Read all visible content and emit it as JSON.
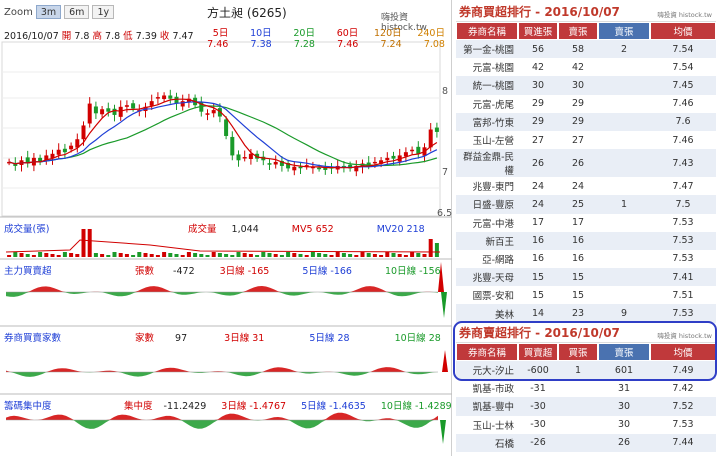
{
  "toolbar": {
    "zoom_label": "Zoom",
    "zoom_options": [
      "3m",
      "6m",
      "1y"
    ],
    "zoom_active": "3m"
  },
  "stock": {
    "title": "方土昶 (6265)",
    "source": "嗨投資 histock.tw",
    "date": "2016/10/07",
    "open_label": "開",
    "open": "7.8",
    "high_label": "高",
    "high": "7.8",
    "low_label": "低",
    "low": "7.39",
    "close_label": "收",
    "close": "7.47"
  },
  "ma": {
    "headers": [
      "5日",
      "10日",
      "20日",
      "60日",
      "120日",
      "240日"
    ],
    "values": [
      "7.46",
      "7.38",
      "7.28",
      "7.46",
      "7.24",
      "7.08"
    ],
    "colors": [
      "#d10000",
      "#1f3fd6",
      "#1a9a2a",
      "#d10000",
      "#c07000",
      "#d08000"
    ]
  },
  "price_axis": [
    "8",
    "7",
    "6.5"
  ],
  "volume": {
    "panel_label": "成交量(張)",
    "vol_label": "成交量",
    "vol_value": "1,044",
    "mv5_label": "MV5",
    "mv5_value": "652",
    "mv20_label": "MV20",
    "mv20_value": "218"
  },
  "main_force": {
    "panel_label": "主力買賣超",
    "value_label": "張數",
    "value": "-472",
    "l3_label": "3日線",
    "l3_value": "-165",
    "l5_label": "5日線",
    "l5_value": "-166",
    "l10_label": "10日線",
    "l10_value": "-156"
  },
  "broker_count": {
    "panel_label": "券商買賣家數",
    "value_label": "家數",
    "value": "97",
    "l3_label": "3日線",
    "l3_value": "31",
    "l5_label": "5日線",
    "l5_value": "28",
    "l10_label": "10日線",
    "l10_value": "28"
  },
  "concentration": {
    "panel_label": "籌碼集中度",
    "value_label": "集中度",
    "value": "-11.2429",
    "l3_label": "3日線",
    "l3_value": "-1.4767",
    "l5_label": "5日線",
    "l5_value": "-1.4635",
    "l10_label": "10日線",
    "l10_value": "-1.4289"
  },
  "buy_ranking": {
    "title": "券商買超排行 - 2016/10/07",
    "brand": "嗨投資 histock.tw",
    "headers": [
      "券商名稱",
      "買進張",
      "賣張",
      "賣張",
      "均價"
    ],
    "rows": [
      [
        "第一金-桃園",
        "56",
        "58",
        "2",
        "7.54"
      ],
      [
        "元富-桃園",
        "42",
        "42",
        "",
        "7.54"
      ],
      [
        "統一-桃園",
        "30",
        "30",
        "",
        "7.45"
      ],
      [
        "元富-虎尾",
        "29",
        "29",
        "",
        "7.46"
      ],
      [
        "富邦-竹東",
        "29",
        "29",
        "",
        "7.6"
      ],
      [
        "玉山-左營",
        "27",
        "27",
        "",
        "7.46"
      ],
      [
        "群益金鼎-民權",
        "26",
        "26",
        "",
        "7.43"
      ],
      [
        "兆豐-東門",
        "24",
        "24",
        "",
        "7.47"
      ],
      [
        "日盛-豐原",
        "24",
        "25",
        "1",
        "7.5"
      ],
      [
        "元富-中港",
        "17",
        "17",
        "",
        "7.53"
      ],
      [
        "新百王",
        "16",
        "16",
        "",
        "7.53"
      ],
      [
        "亞-網路",
        "16",
        "16",
        "",
        "7.53"
      ],
      [
        "兆豐-天母",
        "15",
        "15",
        "",
        "7.41"
      ],
      [
        "國票-安和",
        "15",
        "15",
        "",
        "7.51"
      ],
      [
        "美林",
        "14",
        "23",
        "9",
        "7.53"
      ]
    ]
  },
  "sell_ranking": {
    "title": "券商賣超排行 - 2016/10/07",
    "brand": "嗨投資 histock.tw",
    "headers": [
      "券商名稱",
      "買賣超",
      "買張",
      "賣張",
      "均價"
    ],
    "rows": [
      [
        "元大-汐止",
        "-600",
        "1",
        "601",
        "7.49"
      ],
      [
        "凱基-市政",
        "-31",
        "",
        "31",
        "7.42"
      ],
      [
        "凱基-豐中",
        "-30",
        "",
        "30",
        "7.52"
      ],
      [
        "玉山-士林",
        "-30",
        "",
        "30",
        "7.53"
      ],
      [
        "石橋",
        "-26",
        "",
        "26",
        "7.44"
      ]
    ]
  },
  "colors": {
    "up": "#d10000",
    "down": "#1a9a2a",
    "ma5": "#d10000",
    "ma10": "#1f3fd6",
    "ma20": "#1a9a2a",
    "header_red": "#c0393b",
    "header_blue": "#4a72b0",
    "highlight": "#2f3ec6"
  }
}
